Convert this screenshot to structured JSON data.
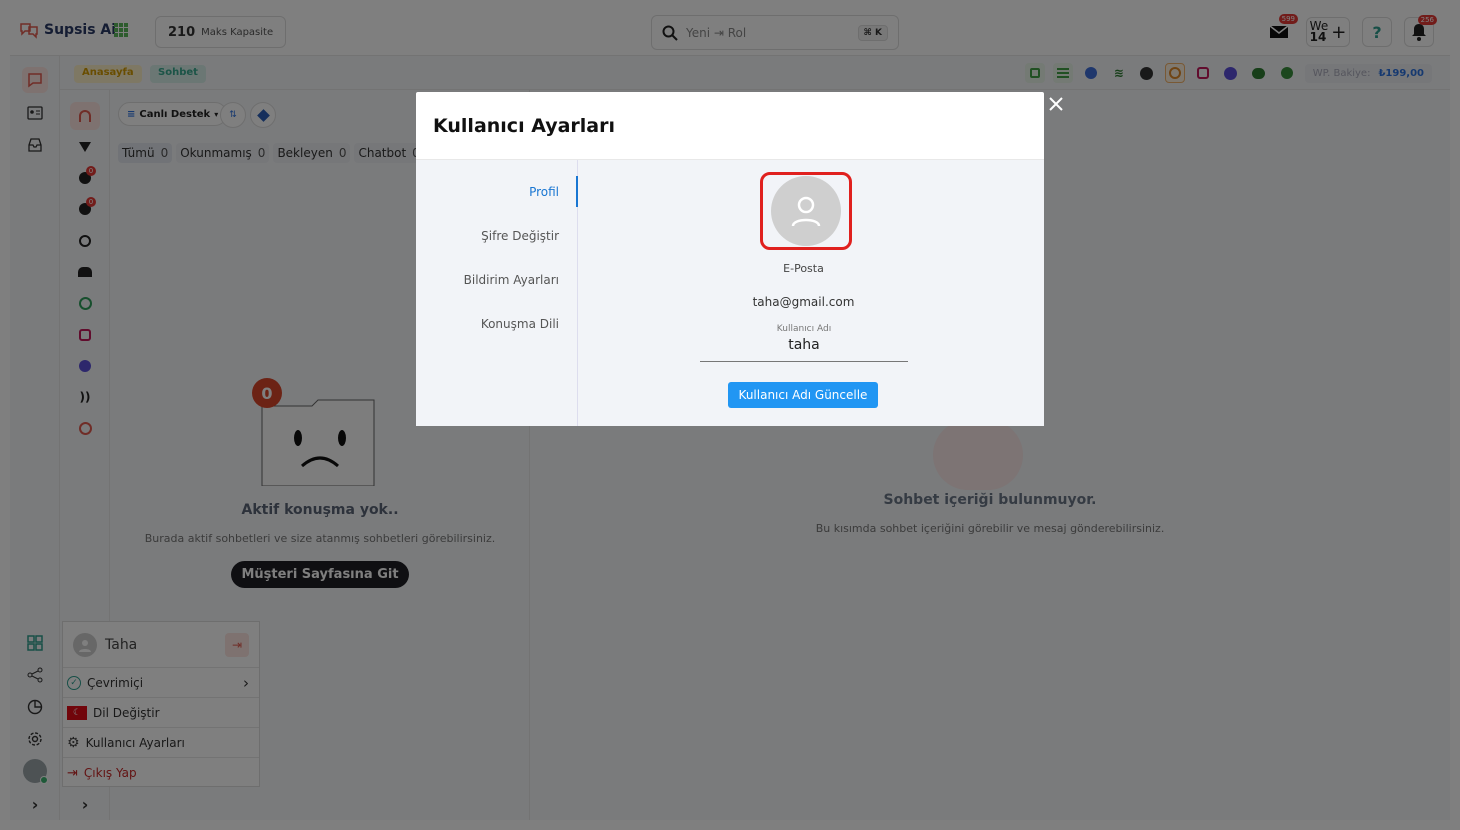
{
  "app": {
    "name": "Supsis Ai"
  },
  "capacity": {
    "value": "210",
    "label": "Maks Kapasite"
  },
  "search": {
    "placeholder": "Yeni ⇥ Rol",
    "shortcut": "⌘ K"
  },
  "topbar": {
    "mail_badge": "599",
    "we_label": "We",
    "we_count": "14",
    "notif_badge": "256"
  },
  "breadcrumb": {
    "home": "Anasayfa",
    "chat": "Sohbet"
  },
  "balance": {
    "label": "WP. Bakiye:",
    "value": "₺199,00"
  },
  "chat_list": {
    "filter_label": "Canlı Destek",
    "tabs": [
      {
        "label": "Tümü",
        "count": "0"
      },
      {
        "label": "Okunmamış",
        "count": "0"
      },
      {
        "label": "Bekleyen",
        "count": "0"
      },
      {
        "label": "Chatbot",
        "count": "0"
      }
    ],
    "empty": {
      "count": "0",
      "title": "Aktif konuşma yok..",
      "subtitle": "Burada aktif sohbetleri ve size atanmış sohbetleri görebilirsiniz.",
      "button": "Müşteri Sayfasına Git"
    }
  },
  "main_empty": {
    "title": "Sohbet içeriği bulunmuyor.",
    "subtitle": "Bu kısımda sohbet içeriğini görebilir ve mesaj gönderebilirsiniz."
  },
  "user_menu": {
    "name": "Taha",
    "items": [
      {
        "label": "Çevrimiçi"
      },
      {
        "label": "Dil Değiştir"
      },
      {
        "label": "Kullanıcı Ayarları"
      },
      {
        "label": "Çıkış Yap"
      }
    ]
  },
  "modal": {
    "title": "Kullanıcı Ayarları",
    "nav": [
      "Profil",
      "Şifre Değiştir",
      "Bildirim Ayarları",
      "Konuşma Dili"
    ],
    "email_label": "E-Posta",
    "email_value": "taha@gmail.com",
    "username_label": "Kullanıcı Adı",
    "username_value": "taha",
    "update_button": "Kullanıcı Adı Güncelle"
  },
  "colors": {
    "accent": "#2196f3",
    "danger": "#e0201e",
    "brand_bg": "#f4f6f9"
  }
}
